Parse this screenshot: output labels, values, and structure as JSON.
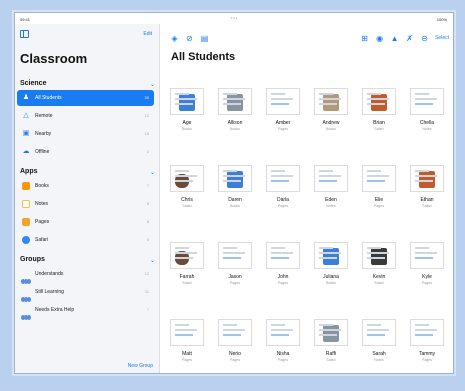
{
  "status": {
    "time": "09:41",
    "battery": "100%"
  },
  "sidebar": {
    "edit_label": "Edit",
    "title": "Classroom",
    "sections": [
      {
        "label": "Science",
        "items": [
          {
            "label": "All Students",
            "count": "30",
            "icon": "students-icon",
            "selected": true
          },
          {
            "label": "Remote",
            "count": "12",
            "icon": "remote-icon"
          },
          {
            "label": "Nearby",
            "count": "18",
            "icon": "nearby-icon"
          },
          {
            "label": "Offline",
            "count": "2",
            "icon": "offline-icon"
          }
        ]
      },
      {
        "label": "Apps",
        "items": [
          {
            "label": "Books",
            "count": "7",
            "icon": "books-app-icon"
          },
          {
            "label": "Notes",
            "count": "8",
            "icon": "notes-app-icon"
          },
          {
            "label": "Pages",
            "count": "8",
            "icon": "pages-app-icon"
          },
          {
            "label": "Safari",
            "count": "6",
            "icon": "safari-app-icon"
          }
        ]
      },
      {
        "label": "Groups",
        "items": [
          {
            "label": "Understands",
            "count": "12",
            "icon": "group-icon"
          },
          {
            "label": "Still Learning",
            "count": "11",
            "icon": "group-icon"
          },
          {
            "label": "Needs Extra Help",
            "count": "7",
            "icon": "group-icon"
          }
        ]
      }
    ],
    "new_group_label": "New Group"
  },
  "toolbar": {
    "select_label": "Select"
  },
  "main": {
    "title": "All Students",
    "students": [
      {
        "name": "Age",
        "app": "Books",
        "thumb": "blue"
      },
      {
        "name": "Allison",
        "app": "Books",
        "thumb": "gray"
      },
      {
        "name": "Amber",
        "app": "Pages",
        "thumb": "doc"
      },
      {
        "name": "Andrew",
        "app": "Books",
        "thumb": "beige"
      },
      {
        "name": "Brian",
        "app": "Safari",
        "thumb": "orange"
      },
      {
        "name": "Chella",
        "app": "Notes",
        "thumb": "doc"
      },
      {
        "name": "Chris",
        "app": "Safari",
        "thumb": "mam"
      },
      {
        "name": "Daren",
        "app": "Books",
        "thumb": "blue"
      },
      {
        "name": "Darla",
        "app": "Pages",
        "thumb": "doc"
      },
      {
        "name": "Eden",
        "app": "Notes",
        "thumb": "doc"
      },
      {
        "name": "Elie",
        "app": "Pages",
        "thumb": "doc"
      },
      {
        "name": "Ethan",
        "app": "Safari",
        "thumb": "orange"
      },
      {
        "name": "Farrah",
        "app": "Safari",
        "thumb": "mam"
      },
      {
        "name": "Jason",
        "app": "Pages",
        "thumb": "doc"
      },
      {
        "name": "John",
        "app": "Pages",
        "thumb": "doc"
      },
      {
        "name": "Juliana",
        "app": "Books",
        "thumb": "blue"
      },
      {
        "name": "Kevin",
        "app": "Safari",
        "thumb": "dark"
      },
      {
        "name": "Kyle",
        "app": "Pages",
        "thumb": "doc"
      },
      {
        "name": "Matt",
        "app": "Pages",
        "thumb": "doc"
      },
      {
        "name": "Nerio",
        "app": "Pages",
        "thumb": "doc"
      },
      {
        "name": "Nisha",
        "app": "Pages",
        "thumb": "doc"
      },
      {
        "name": "Raffi",
        "app": "Safari",
        "thumb": "gray"
      },
      {
        "name": "Sarah",
        "app": "Notes",
        "thumb": "doc"
      },
      {
        "name": "Tammy",
        "app": "Pages",
        "thumb": "doc"
      }
    ]
  },
  "colors": {
    "accent": "#1a7cf2",
    "background": "#b9d0ee"
  }
}
